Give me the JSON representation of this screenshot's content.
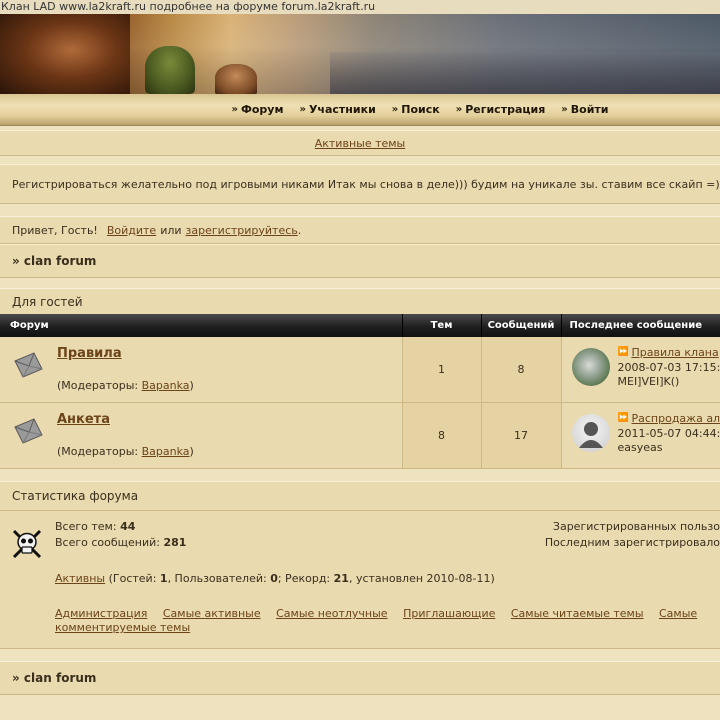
{
  "window": {
    "title": "Клан LAD www.la2kraft.ru подробнее на форуме forum.la2kraft.ru"
  },
  "nav": {
    "items": [
      "Форум",
      "Участники",
      "Поиск",
      "Регистрация",
      "Войти"
    ]
  },
  "active_topics": "Активные темы",
  "announcement": "Регистрироваться желательно под игровыми никами Итак мы снова в деле))) будим на уникале зы. ставим все скайп =)",
  "greeting": {
    "prefix": "Привет, Гость!",
    "login": "Войдите",
    "or": "или",
    "register": "зарегистрируйтесь",
    "suffix": "."
  },
  "breadcrumb": "» clan forum",
  "section": {
    "title": "Для гостей",
    "columns": {
      "forum": "Форум",
      "topics": "Тем",
      "posts": "Сообщений",
      "last": "Последнее сообщение"
    },
    "forums": [
      {
        "title": "Правила",
        "mods_prefix": "(Модераторы:",
        "mod": "Bapanka",
        "mods_suffix": ")",
        "topics": "1",
        "posts": "8",
        "last_title": "Правила клана",
        "last_date": "2008-07-03 17:15:",
        "last_user": "MEI]VEI]K()"
      },
      {
        "title": "Анкета",
        "mods_prefix": "(Модераторы:",
        "mod": "Bapanka",
        "mods_suffix": ")",
        "topics": "8",
        "posts": "17",
        "last_title": "Распродажа ал",
        "last_date": "2011-05-07 04:44:",
        "last_user": "easyeas"
      }
    ]
  },
  "stats": {
    "title": "Статистика форума",
    "total_topics_label": "Всего тем:",
    "total_topics": "44",
    "total_posts_label": "Всего сообщений:",
    "total_posts": "281",
    "registered_label": "Зарегистрированных пользо",
    "last_registered_label": "Последним зарегистрировало",
    "active_link": "Активны",
    "guests_label": "(Гостей:",
    "guests": "1",
    "users_label": ", Пользователей:",
    "users": "0",
    "record_label": "; Рекорд:",
    "record": "21",
    "record_suffix": ", установлен 2010-08-11)",
    "links": [
      "Администрация",
      "Самые активные",
      "Самые неотлучные",
      "Приглашающие",
      "Самые читаемые темы",
      "Самые комментируемые темы"
    ]
  },
  "footer_breadcrumb": "» clan forum"
}
